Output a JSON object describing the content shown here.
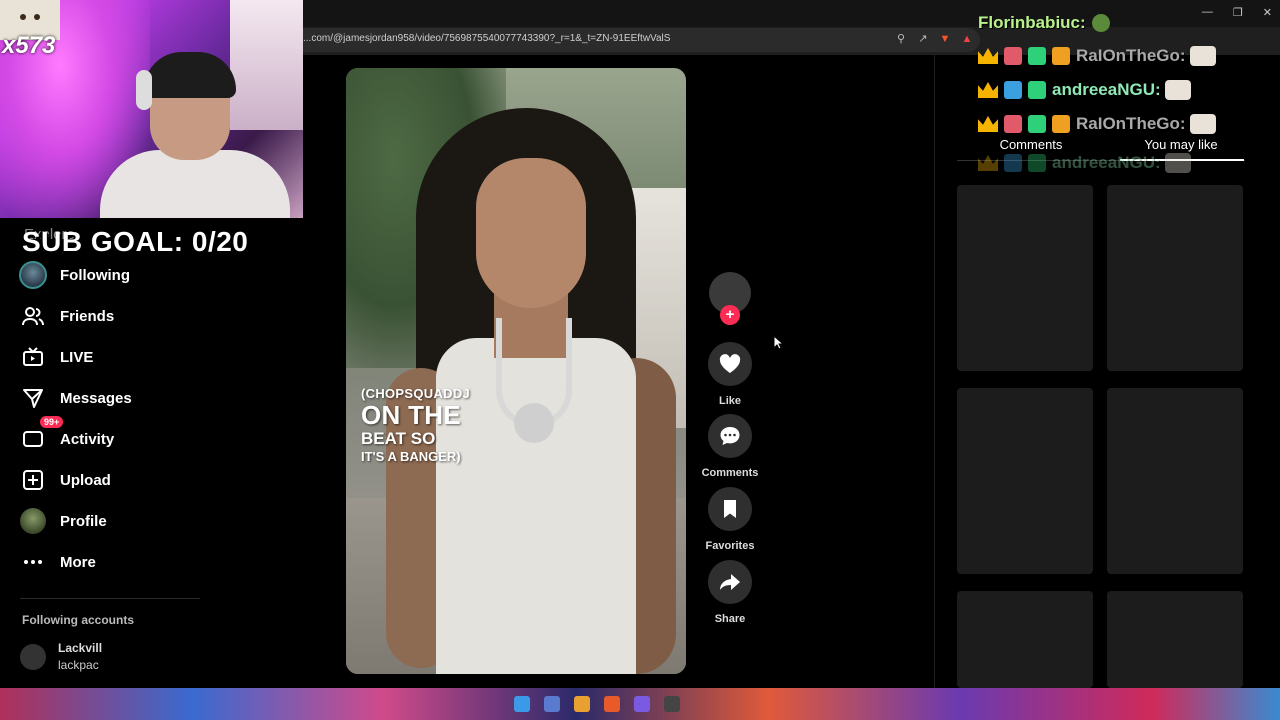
{
  "browser": {
    "url": "...com/@jamesjordan958/video/7569875540077743390?_r=1&_t=ZN-91EEftwValS",
    "icons": [
      "zoom-icon",
      "share-icon",
      "brave-shield-icon",
      "rewards-icon"
    ]
  },
  "stream_overlay": {
    "counter": "x573",
    "sub_goal": "SUB GOAL: 0/20"
  },
  "sidebar": {
    "explore_label": "Explore",
    "items": [
      {
        "label": "Following",
        "icon": "following-avatar-icon"
      },
      {
        "label": "Friends",
        "icon": "friends-icon"
      },
      {
        "label": "LIVE",
        "icon": "live-tv-icon"
      },
      {
        "label": "Messages",
        "icon": "paper-plane-icon"
      },
      {
        "label": "Activity",
        "icon": "activity-icon",
        "badge": "99+"
      },
      {
        "label": "Upload",
        "icon": "upload-plus-icon"
      },
      {
        "label": "Profile",
        "icon": "profile-avatar-icon"
      },
      {
        "label": "More",
        "icon": "ellipsis-icon"
      }
    ],
    "following_accounts_heading": "Following accounts",
    "following_accounts": [
      {
        "name": "Lackvill",
        "handle": "lackpac"
      }
    ]
  },
  "video": {
    "caption_line1": "(CHOPSQUADDJ",
    "caption_line2": "ON THE",
    "caption_line3": "BEAT SO",
    "caption_line4": "IT'S A BANGER)"
  },
  "actions": {
    "follow": "+",
    "like": "Like",
    "comments": "Comments",
    "favorites": "Favorites",
    "share": "Share"
  },
  "right_panel": {
    "tabs": [
      "Comments",
      "You may like"
    ],
    "active_tab": "You may like"
  },
  "chat": [
    {
      "user": "Florinbabiuc:",
      "color": "#b9f28a"
    },
    {
      "user": "RaIOnTheGo:",
      "color": "#a9a9a9"
    },
    {
      "user": "andreeaNGU:",
      "color": "#8fe8b6"
    },
    {
      "user": "RaIOnTheGo:",
      "color": "#a9a9a9"
    },
    {
      "user": "andreeaNGU:",
      "color": "#8fe8b6"
    }
  ],
  "colors": {
    "accent_red": "#fe2c55",
    "crown_gold": "#f5b400"
  }
}
